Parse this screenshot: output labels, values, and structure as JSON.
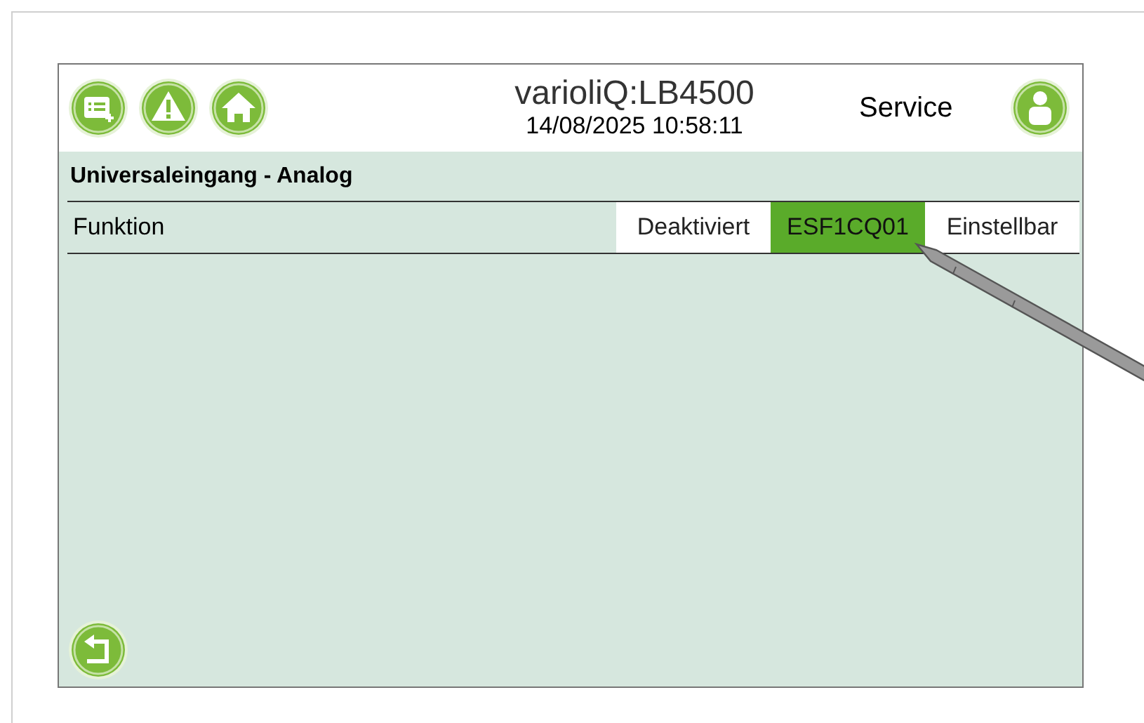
{
  "header": {
    "device": "varioliQ:LB4500",
    "datetime": "14/08/2025 10:58:11",
    "role": "Service"
  },
  "section_title": "Universaleingang - Analog",
  "rows": [
    {
      "label": "Funktion",
      "options": [
        {
          "label": "Deaktiviert",
          "selected": false
        },
        {
          "label": "ESF1CQ01",
          "selected": true
        },
        {
          "label": "Einstellbar",
          "selected": false
        }
      ]
    }
  ]
}
